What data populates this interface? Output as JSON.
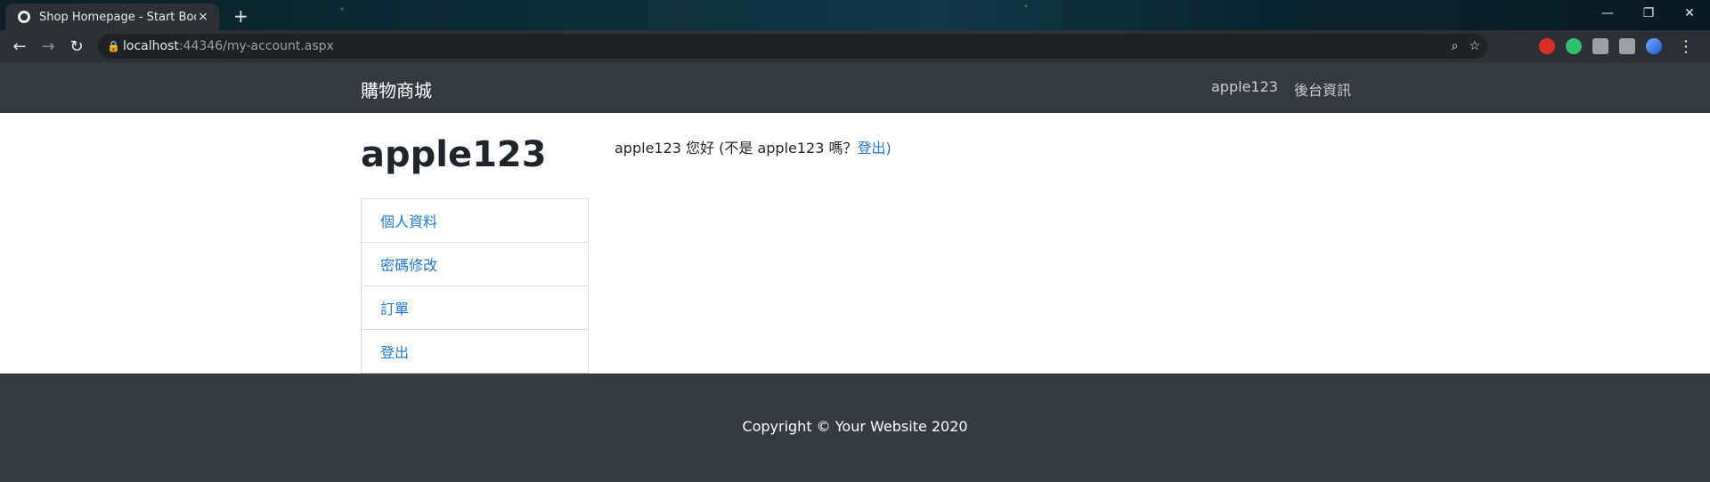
{
  "browser": {
    "tab_title": "Shop Homepage - Start Bootst",
    "tab_close": "×",
    "new_tab": "+",
    "url_host": "localhost",
    "url_rest": ":44346/my-account.aspx",
    "icons": [
      "globe-icon",
      "back-icon",
      "forward-icon",
      "reload-icon",
      "lock-icon",
      "zoom-icon",
      "star-icon",
      "extension-icon",
      "menu-icon"
    ]
  },
  "site": {
    "brand": "購物商城",
    "nav": [
      "apple123",
      "後台資訊"
    ]
  },
  "account": {
    "heading": "apple123",
    "greeting_prefix": "apple123 您好 (不是 apple123 嗎？",
    "greeting_link": "登出)",
    "sidebar": [
      "個人資料",
      "密碼修改",
      "訂單",
      "登出"
    ]
  },
  "footer": {
    "copyright": "Copyright © Your Website 2020"
  }
}
